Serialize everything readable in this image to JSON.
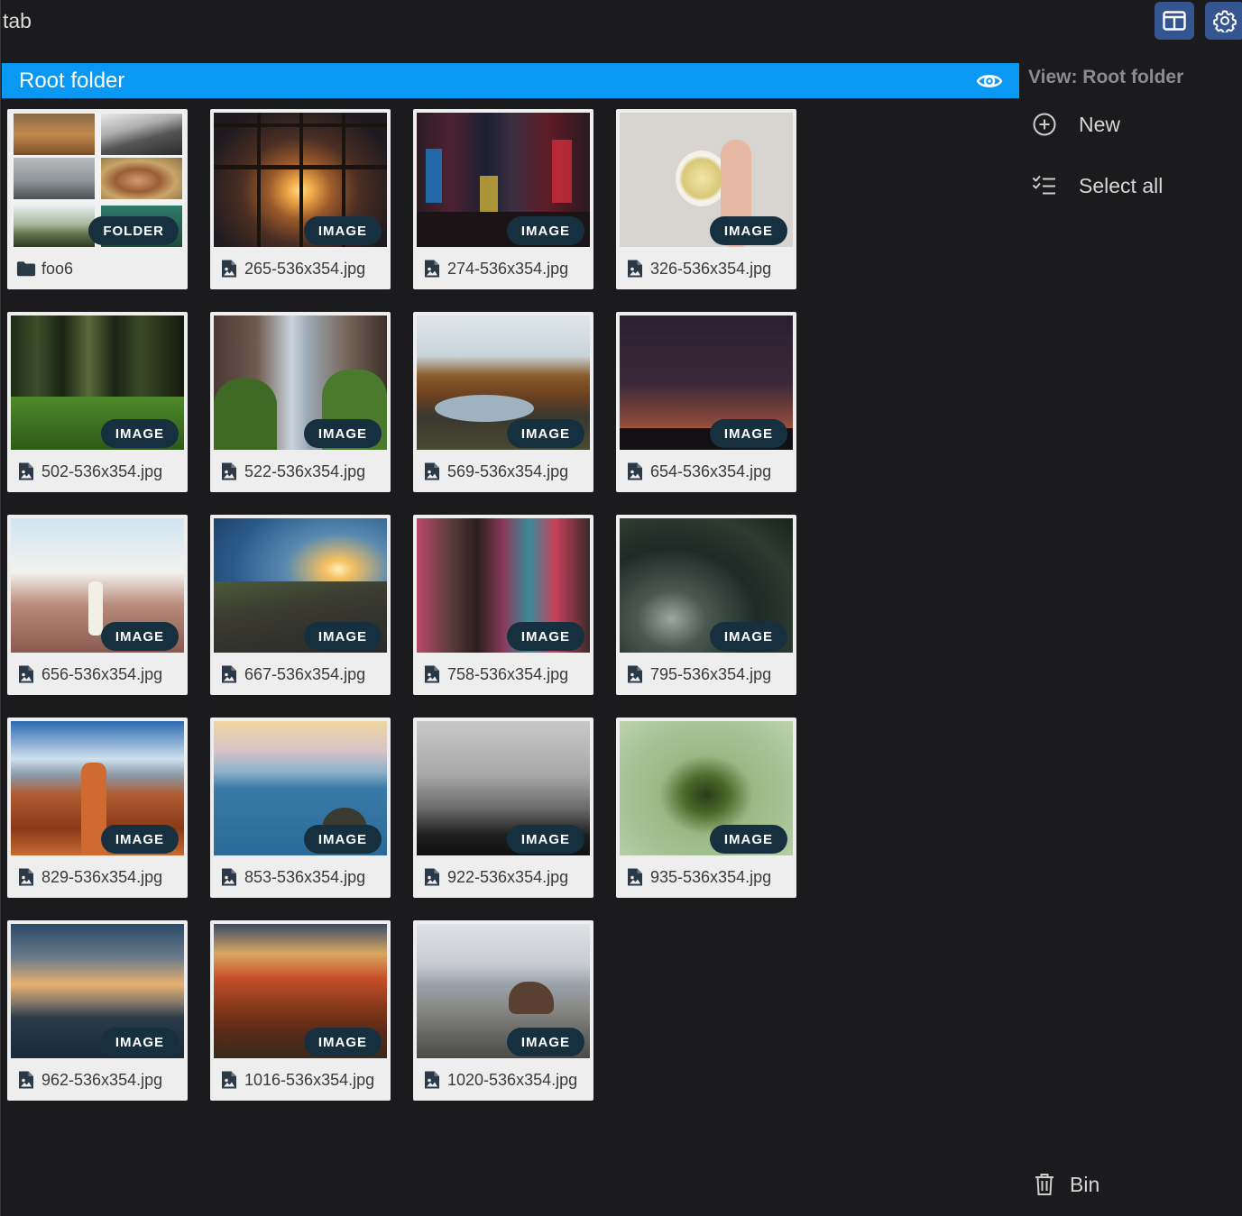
{
  "tab": {
    "label": "tab"
  },
  "header": {
    "title": "Root folder"
  },
  "sidebar": {
    "title": "View: Root folder",
    "new_label": "New",
    "select_all_label": "Select all",
    "bin_label": "Bin"
  },
  "badges": {
    "folder": "FOLDER",
    "image": "IMAGE"
  },
  "items": [
    {
      "type": "folder",
      "name": "foo6"
    },
    {
      "type": "image",
      "name": "265-536x354.jpg"
    },
    {
      "type": "image",
      "name": "274-536x354.jpg"
    },
    {
      "type": "image",
      "name": "326-536x354.jpg"
    },
    {
      "type": "image",
      "name": "502-536x354.jpg"
    },
    {
      "type": "image",
      "name": "522-536x354.jpg"
    },
    {
      "type": "image",
      "name": "569-536x354.jpg"
    },
    {
      "type": "image",
      "name": "654-536x354.jpg"
    },
    {
      "type": "image",
      "name": "656-536x354.jpg"
    },
    {
      "type": "image",
      "name": "667-536x354.jpg"
    },
    {
      "type": "image",
      "name": "758-536x354.jpg"
    },
    {
      "type": "image",
      "name": "795-536x354.jpg"
    },
    {
      "type": "image",
      "name": "829-536x354.jpg"
    },
    {
      "type": "image",
      "name": "853-536x354.jpg"
    },
    {
      "type": "image",
      "name": "922-536x354.jpg"
    },
    {
      "type": "image",
      "name": "935-536x354.jpg"
    },
    {
      "type": "image",
      "name": "962-536x354.jpg"
    },
    {
      "type": "image",
      "name": "1016-536x354.jpg"
    },
    {
      "type": "image",
      "name": "1020-536x354.jpg"
    }
  ],
  "colors": {
    "accent": "#0a98f5",
    "top_button": "#34558f",
    "background": "#1b1b1d",
    "card": "#eeeeee",
    "badge": "#173040"
  }
}
